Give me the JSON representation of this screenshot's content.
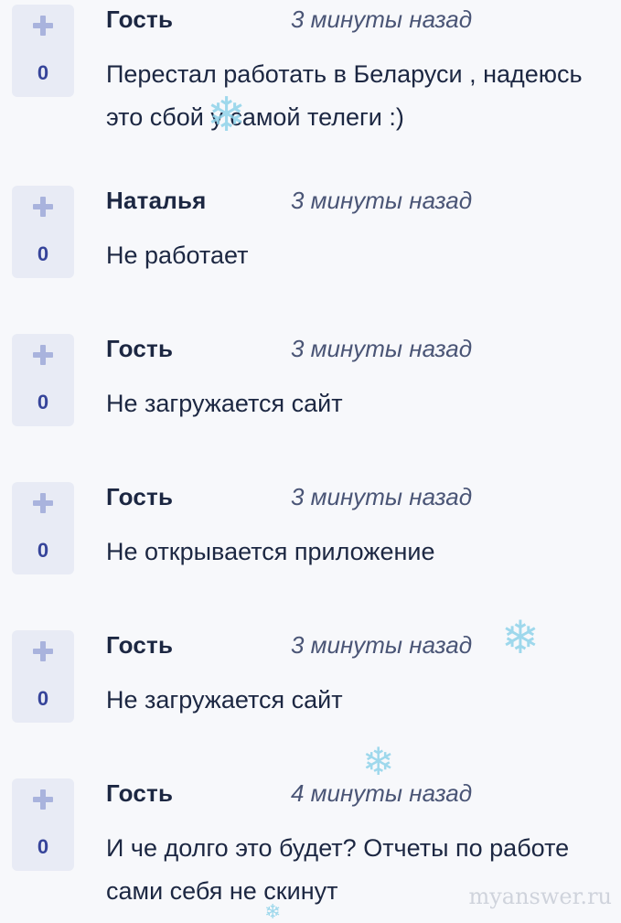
{
  "comments": [
    {
      "votes": "0",
      "author": "Гость",
      "time": "3 минуты назад",
      "text": "Перестал работать в Беларуси , надеюсь это сбой у самой телеги :)"
    },
    {
      "votes": "0",
      "author": "Наталья",
      "time": "3 минуты назад",
      "text": "Не работает"
    },
    {
      "votes": "0",
      "author": "Гость",
      "time": "3 минуты назад",
      "text": "Не загружается сайт"
    },
    {
      "votes": "0",
      "author": "Гость",
      "time": "3 минуты назад",
      "text": "Не открывается приложение"
    },
    {
      "votes": "0",
      "author": "Гость",
      "time": "3 минуты назад",
      "text": "Не загружается сайт"
    },
    {
      "votes": "0",
      "author": "Гость",
      "time": "4 минуты назад",
      "text": "И че долго это будет? Отчеты по работе сами себя не скинут"
    }
  ],
  "icons": {
    "upvote": "plus-icon",
    "decoration": "snowflake-icon"
  },
  "watermark": "myanswer.ru",
  "colors": {
    "background": "#f7f8fb",
    "vote_box": "#e8ebf5",
    "vote_plus": "#a9b3dd",
    "vote_count": "#36449a",
    "text": "#1c2742",
    "time": "#4a5576",
    "snowflake": "#8fd3ea"
  }
}
